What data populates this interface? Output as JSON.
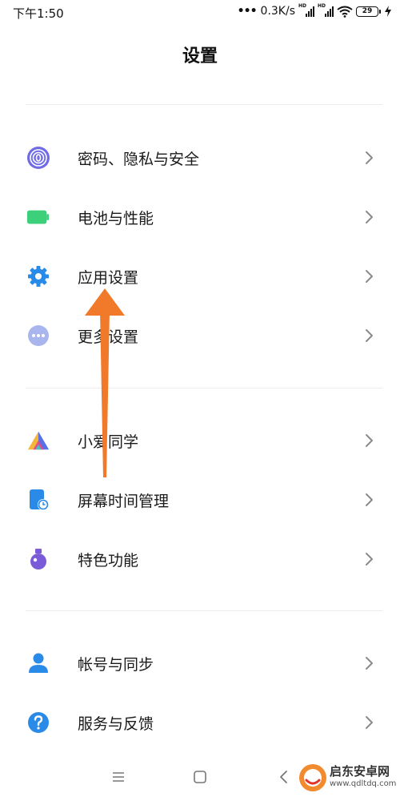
{
  "status_bar": {
    "time": "下午1:50",
    "network_speed": "0.3K/s",
    "sim1_label": "HD",
    "sim2_label": "HD",
    "battery_level": "29"
  },
  "header": {
    "title": "设置"
  },
  "sections": [
    {
      "items": [
        {
          "label": "密码、隐私与安全",
          "icon": "fingerprint-icon",
          "color": "#6f6ce6"
        },
        {
          "label": "电池与性能",
          "icon": "battery-icon",
          "color": "#3dd07a"
        },
        {
          "label": "应用设置",
          "icon": "gear-icon",
          "color": "#2a8ae8"
        },
        {
          "label": "更多设置",
          "icon": "more-dots-icon",
          "color": "#a9b6ee"
        }
      ]
    },
    {
      "items": [
        {
          "label": "小爱同学",
          "icon": "xiaoai-icon",
          "color": "#5a6fe6"
        },
        {
          "label": "屏幕时间管理",
          "icon": "screen-time-icon",
          "color": "#2a8ae8"
        },
        {
          "label": "特色功能",
          "icon": "flask-icon",
          "color": "#7a5cd8"
        }
      ]
    },
    {
      "items": [
        {
          "label": "帐号与同步",
          "icon": "account-icon",
          "color": "#2a8ae8"
        },
        {
          "label": "服务与反馈",
          "icon": "help-icon",
          "color": "#2a8ae8"
        }
      ]
    }
  ],
  "watermark": {
    "name": "启东安卓网",
    "url": "www.qdltdq.com"
  },
  "annotation": {
    "arrow_color": "#f07a2a"
  }
}
